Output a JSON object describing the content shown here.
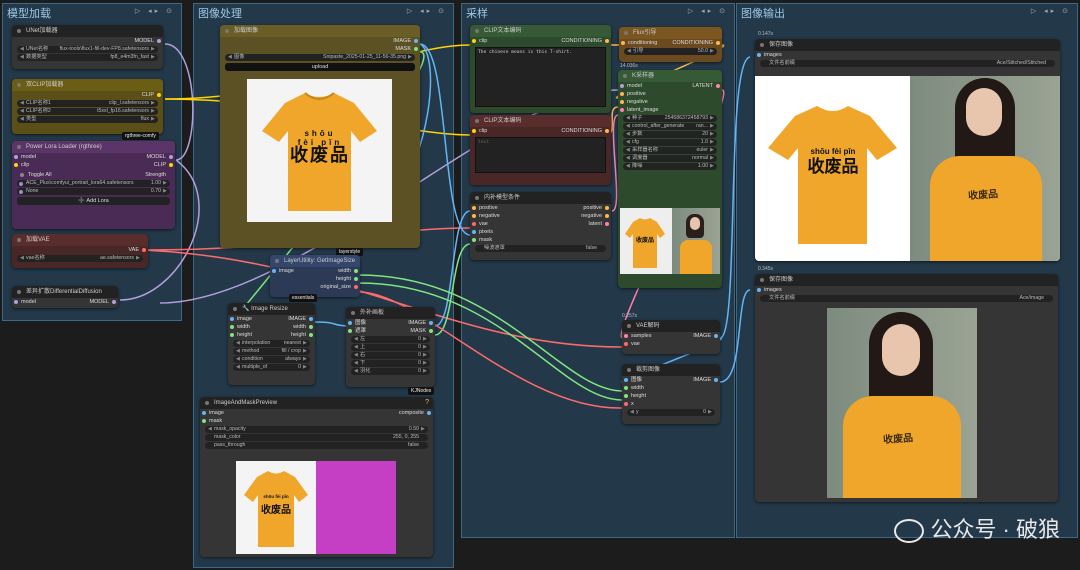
{
  "groups": {
    "model_load": "模型加载",
    "image_process": "图像处理",
    "sampling": "采样",
    "image_output": "图像输出"
  },
  "group_icons": "▷ ◂▸ ⊙",
  "unet": {
    "title": "UNet加载器",
    "out": "MODEL",
    "name_label": "UNet名称",
    "name_value": "flux-tools\\flux1-fill-dev-FP8.safetensors",
    "dtype_label": "数据类型",
    "dtype_value": "fp8_e4m3fn_fast"
  },
  "dualclip": {
    "title": "双CLIP加载器",
    "out": "CLIP",
    "clip1_label": "CLIP名称1",
    "clip1_value": "clip_l.safetensors",
    "clip2_label": "CLIP名称2",
    "clip2_value": "t5xxl_fp16.safetensors",
    "type_label": "类型",
    "type_value": "flux",
    "badge": "rgthree-comfy"
  },
  "lora": {
    "title": "Power Lora Loader (rgthree)",
    "in_model": "model",
    "in_clip": "clip",
    "out_model": "MODEL",
    "out_clip": "CLIP",
    "toggle_all": "Toggle All",
    "strength": "Strength",
    "lora1_name": "ACE_Plus\\comfyui_portrait_lora64.safetensors",
    "lora1_value": "1.00",
    "lora2_name": "None",
    "lora2_value": "0.70",
    "add_lora": "➕ Add Lora"
  },
  "vae_loader": {
    "title": "加载VAE",
    "out": "VAE",
    "name_label": "vae名称",
    "name_value": "ae.safetensors"
  },
  "diffdiff": {
    "title": "差异扩散DifferentialDiffusion",
    "in": "model",
    "out": "MODEL"
  },
  "load_image": {
    "title": "加载图像",
    "out_image": "IMAGE",
    "out_mask": "MASK",
    "file_label": "图像",
    "file_value": "Snipaste_2025-01-25_11-56-35.png",
    "upload": "upload"
  },
  "shirt_text": {
    "pinyin1": "shōu",
    "pinyin2": "fèi",
    "pinyin3": "pǐn",
    "hanzi": "收废品"
  },
  "get_size": {
    "title": "LayerUtility: GetImageSize",
    "in": "image",
    "out_w": "width",
    "out_h": "height",
    "out_size": "original_size",
    "badge_top": "layerstyle",
    "badge_bottom": "essentials"
  },
  "resize": {
    "title": "🔧 Image Resize",
    "in_image": "image",
    "in_width": "width",
    "in_height": "height",
    "out_image": "IMAGE",
    "out_width": "width",
    "out_height": "height",
    "interp_label": "interpolation",
    "interp_value": "nearest",
    "method_label": "method",
    "method_value": "fill / crop",
    "cond_label": "condition",
    "cond_value": "always",
    "mult_label": "multiple_of",
    "mult_value": "0"
  },
  "pad": {
    "title": "外补画板",
    "in_image": "图像",
    "in_mask": "遮罩",
    "out_image": "IMAGE",
    "out_mask": "MASK",
    "left_label": "左",
    "left_value": "0",
    "top_label": "上",
    "top_value": "0",
    "right_label": "右",
    "right_value": "0",
    "bottom_label": "下",
    "bottom_value": "0",
    "feather_label": "羽化",
    "feather_value": "0",
    "badge": "KJNodes"
  },
  "mask_preview": {
    "title": "ImageAndMaskPreview",
    "in_image": "image",
    "in_mask": "mask",
    "out": "composite",
    "opacity_label": "mask_opacity",
    "opacity_value": "0.50",
    "color_label": "mask_color",
    "color_value": "255, 0, 255",
    "pass_label": "pass_through",
    "pass_value": "false",
    "help": "?"
  },
  "clip_pos": {
    "title": "CLIP文本编码",
    "in": "clip",
    "out": "CONDITIONING",
    "text": "The chinese means is this T-shirt."
  },
  "clip_neg": {
    "title": "CLIP文本编码",
    "in": "clip",
    "out": "CONDITIONING",
    "placeholder": "text"
  },
  "flux_guide": {
    "title": "Flux引导",
    "in": "conditioning",
    "out": "CONDITIONING",
    "guide_label": "引导",
    "guide_value": "50.0",
    "time": "14.036s"
  },
  "inpaint": {
    "title": "内补模型条件",
    "in_pos": "positive",
    "in_neg": "negative",
    "in_vae": "vae",
    "in_pixels": "pixels",
    "in_mask": "mask",
    "out_pos": "positive",
    "out_neg": "negative",
    "out_latent": "latent",
    "noise_label": "噪波遮罩",
    "noise_value": "false"
  },
  "ksampler": {
    "title": "K采样器",
    "in_model": "model",
    "in_pos": "positive",
    "in_neg": "negative",
    "in_latent": "latent_image",
    "out": "LATENT",
    "seed_label": "种子",
    "seed_value": "254586372458793",
    "control_label": "control_after_generate",
    "control_value": "ran...",
    "steps_label": "步数",
    "steps_value": "20",
    "cfg_label": "cfg",
    "cfg_value": "1.0",
    "sampler_label": "采样器名称",
    "sampler_value": "euler",
    "sched_label": "调度器",
    "sched_value": "normal",
    "denoise_label": "降噪",
    "denoise_value": "1.00"
  },
  "vae_decode": {
    "title": "VAE解码",
    "in_samples": "samples",
    "in_vae": "vae",
    "out": "IMAGE",
    "time": "0.257s"
  },
  "crop": {
    "title": "裁剪图像",
    "in_image": "图像",
    "in_width": "width",
    "in_height": "height",
    "in_x": "x",
    "out": "IMAGE",
    "y_label": "y",
    "y_value": "0"
  },
  "save1": {
    "title": "保存图像",
    "in": "images",
    "prefix_label": "文件名前缀",
    "prefix_value": "Ace/Stitched/Stitched",
    "time": "0.147s"
  },
  "save2": {
    "title": "保存图像",
    "in": "images",
    "prefix_label": "文件名前缀",
    "prefix_value": "Ace/image",
    "time": "0.345s"
  },
  "watermark": "公众号 · 破狼",
  "colors": {
    "shirt": "#f0a62a",
    "mask_magenta": "#c43fc4",
    "group_border": "#3a6a8a"
  }
}
